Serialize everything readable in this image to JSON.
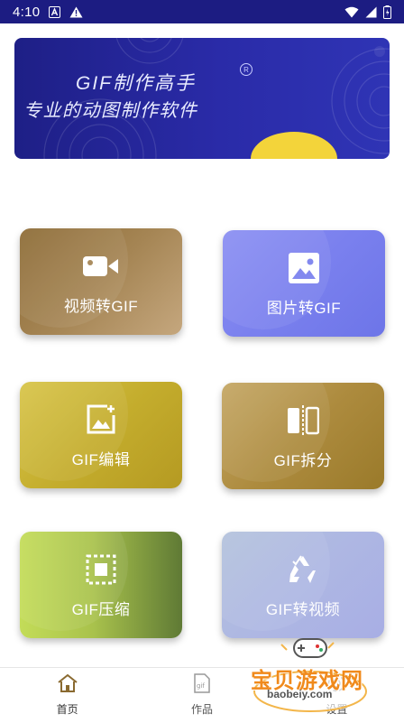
{
  "status_bar": {
    "time": "4:10"
  },
  "banner": {
    "title": "GIF制作高手",
    "subtitle": "专业的动图制作软件",
    "reg_mark": "R"
  },
  "tiles": [
    {
      "label": "视频转GIF",
      "icon": "video-camera-icon"
    },
    {
      "label": "图片转GIF",
      "icon": "image-icon"
    },
    {
      "label": "GIF编辑",
      "icon": "edit-image-icon"
    },
    {
      "label": "GIF拆分",
      "icon": "split-icon"
    },
    {
      "label": "GIF压缩",
      "icon": "compress-icon"
    },
    {
      "label": "GIF转视频",
      "icon": "recycle-arrows-icon"
    }
  ],
  "bottom_nav": {
    "items": [
      {
        "label": "首页",
        "icon": "home-icon",
        "active": true
      },
      {
        "label": "作品",
        "icon": "gif-file-icon",
        "active": false
      },
      {
        "label": "设置",
        "icon": "settings-icon",
        "active": false
      }
    ]
  },
  "watermark": {
    "text": "宝贝游戏网",
    "url": "baobeiy.com"
  },
  "colors": {
    "status_bar_bg": "#1c1c82",
    "banner_bg": "#2a2ba8",
    "tile_video": "#a58554",
    "tile_image": "#7a80ee",
    "tile_edit": "#c4ad2d",
    "tile_split": "#ad8b3e",
    "tile_compress": "#a9c24c",
    "tile_to_video": "#aeb7e3"
  }
}
